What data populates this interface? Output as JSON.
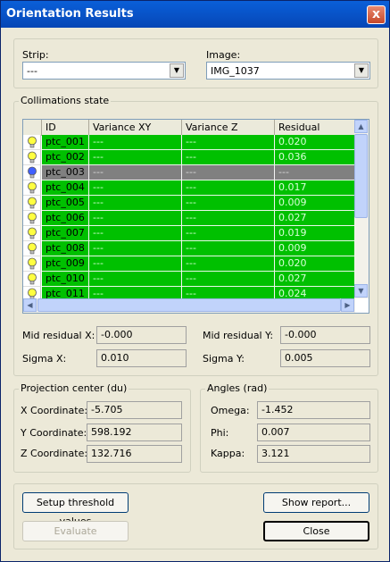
{
  "window": {
    "title": "Orientation Results",
    "close_icon": "x"
  },
  "strip": {
    "label": "Strip:",
    "value": "---"
  },
  "image": {
    "label": "Image:",
    "value": "IMG_1037"
  },
  "collimations": {
    "title": "Collimations state",
    "columns": [
      "ID",
      "Variance XY",
      "Variance Z",
      "Residual"
    ],
    "rows": [
      {
        "id": "ptc_001",
        "vxy": "---",
        "vz": "---",
        "res": "0.020",
        "state": "ok"
      },
      {
        "id": "ptc_002",
        "vxy": "---",
        "vz": "---",
        "res": "0.036",
        "state": "ok"
      },
      {
        "id": "ptc_003",
        "vxy": "---",
        "vz": "---",
        "res": "---",
        "state": "off"
      },
      {
        "id": "ptc_004",
        "vxy": "---",
        "vz": "---",
        "res": "0.017",
        "state": "ok"
      },
      {
        "id": "ptc_005",
        "vxy": "---",
        "vz": "---",
        "res": "0.009",
        "state": "ok"
      },
      {
        "id": "ptc_006",
        "vxy": "---",
        "vz": "---",
        "res": "0.027",
        "state": "ok"
      },
      {
        "id": "ptc_007",
        "vxy": "---",
        "vz": "---",
        "res": "0.019",
        "state": "ok"
      },
      {
        "id": "ptc_008",
        "vxy": "---",
        "vz": "---",
        "res": "0.009",
        "state": "ok"
      },
      {
        "id": "ptc_009",
        "vxy": "---",
        "vz": "---",
        "res": "0.020",
        "state": "ok"
      },
      {
        "id": "ptc_010",
        "vxy": "---",
        "vz": "---",
        "res": "0.027",
        "state": "ok"
      },
      {
        "id": "ptc_011",
        "vxy": "---",
        "vz": "---",
        "res": "0.024",
        "state": "ok"
      }
    ],
    "colors": {
      "ok": "#00c000",
      "off": "#808080",
      "bulb_on": "#ffff40",
      "bulb_off": "#4060ff"
    },
    "mid_res_x_label": "Mid residual X:",
    "mid_res_x": "-0.000",
    "mid_res_y_label": "Mid residual Y:",
    "mid_res_y": "-0.000",
    "sigma_x_label": "Sigma X:",
    "sigma_x": "0.010",
    "sigma_y_label": "Sigma Y:",
    "sigma_y": "0.005"
  },
  "projection": {
    "title": "Projection center (du)",
    "x_label": "X Coordinate:",
    "x": "-5.705",
    "y_label": "Y Coordinate:",
    "y": "598.192",
    "z_label": "Z Coordinate:",
    "z": "132.716"
  },
  "angles": {
    "title": "Angles (rad)",
    "omega_label": "Omega:",
    "omega": "-1.452",
    "phi_label": "Phi:",
    "phi": "0.007",
    "kappa_label": "Kappa:",
    "kappa": "3.121"
  },
  "buttons": {
    "threshold": "Setup threshold values",
    "report": "Show report...",
    "evaluate": "Evaluate",
    "close": "Close"
  }
}
